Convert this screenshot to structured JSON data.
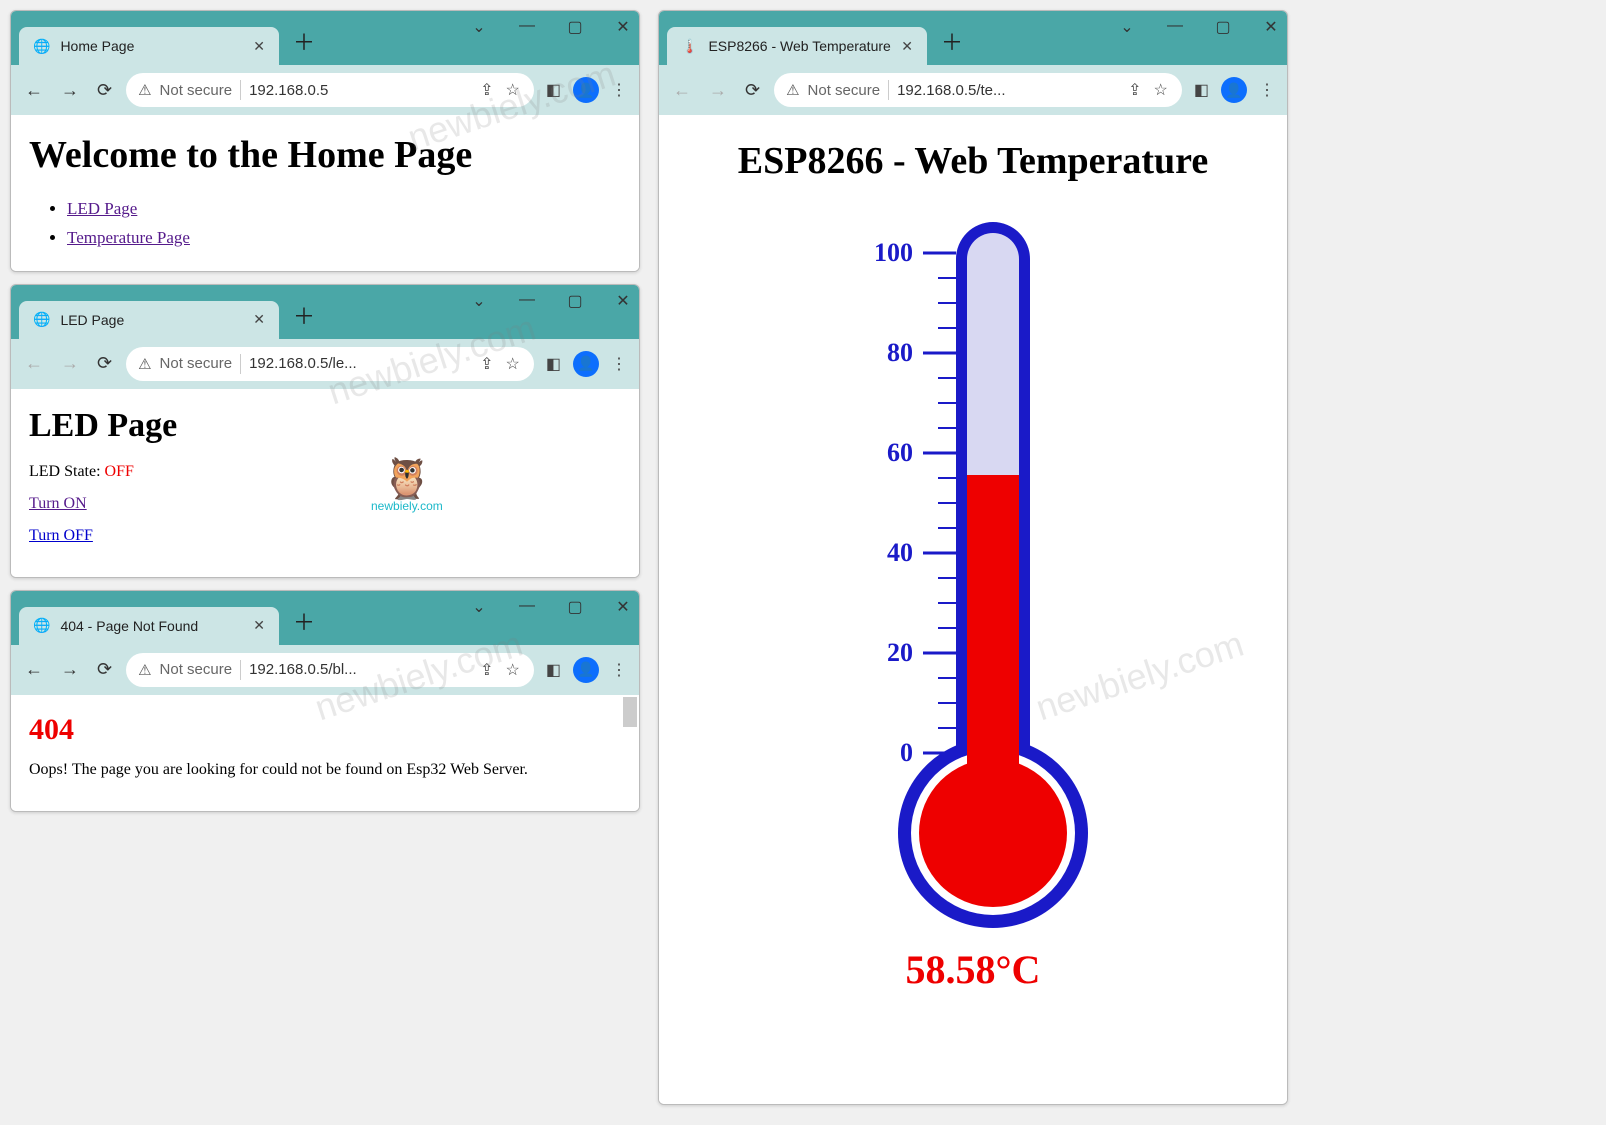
{
  "watermark": "newbiely.com",
  "logo_label": "newbiely.com",
  "win_ctrl": {
    "caret": "⌄",
    "min": "—",
    "max": "▢",
    "close": "✕"
  },
  "toolbar_icons": {
    "back": "←",
    "forward": "→",
    "reload": "⟳",
    "warn": "⚠",
    "share": "⇪",
    "star": "☆",
    "ext": "◧",
    "menu": "⋮"
  },
  "security_label": "Not secure",
  "newtab": "＋",
  "windows": {
    "home": {
      "tab_title": "Home Page",
      "url": "192.168.0.5",
      "heading": "Welcome to the Home Page",
      "links": [
        {
          "label": "LED Page"
        },
        {
          "label": "Temperature Page"
        }
      ]
    },
    "led": {
      "tab_title": "LED Page",
      "url": "192.168.0.5/le...",
      "heading": "LED Page",
      "state_label": "LED State: ",
      "state_value": "OFF",
      "link_on": "Turn ON",
      "link_off": "Turn OFF"
    },
    "notfound": {
      "tab_title": "404 - Page Not Found",
      "url": "192.168.0.5/bl...",
      "heading": "404",
      "body": "Oops! The page you are looking for could not be found on Esp32 Web Server."
    },
    "temp": {
      "tab_title": "ESP8266 - Web Temperature",
      "url": "192.168.0.5/te...",
      "heading": "ESP8266 - Web Temperature",
      "value_display": "58.58°C",
      "scale_labels": [
        "100",
        "80",
        "60",
        "40",
        "20",
        "0"
      ]
    }
  },
  "chart_data": {
    "type": "bar",
    "title": "ESP8266 - Web Temperature",
    "categories": [
      "Temperature"
    ],
    "values": [
      58.58
    ],
    "ylabel": "°C",
    "ylim": [
      0,
      100
    ],
    "ticks": [
      0,
      20,
      40,
      60,
      80,
      100
    ]
  }
}
